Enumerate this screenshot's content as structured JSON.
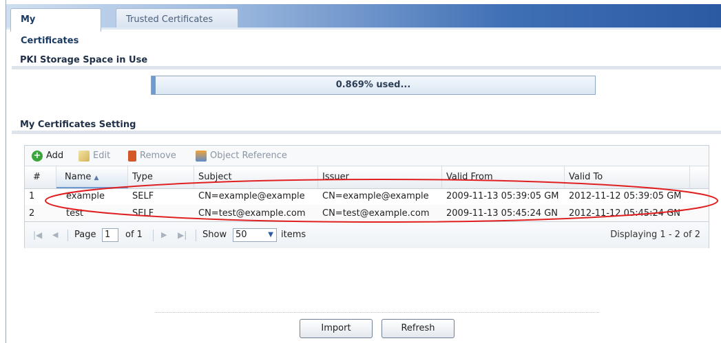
{
  "tabs": [
    {
      "label": "My Certificates",
      "active": true
    },
    {
      "label": "Trusted Certificates",
      "active": false
    }
  ],
  "storage": {
    "section_title": "PKI Storage Space in Use",
    "used_text": "0.869% used...",
    "used_percent": 0.869
  },
  "certs": {
    "section_title": "My Certificates Setting",
    "toolbar": {
      "add": "Add",
      "edit": "Edit",
      "remove": "Remove",
      "object_reference": "Object Reference"
    },
    "columns": [
      "#",
      "Name",
      "Type",
      "Subject",
      "Issuer",
      "Valid From",
      "Valid To"
    ],
    "rows": [
      {
        "num": "1",
        "name": "example",
        "type": "SELF",
        "subject": "CN=example@example",
        "issuer": "CN=example@example",
        "valid_from": "2009-11-13 05:39:05 GM",
        "valid_to": "2012-11-12 05:39:05 GM"
      },
      {
        "num": "2",
        "name": "test",
        "type": "SELF",
        "subject": "CN=test@example.com",
        "issuer": "CN=test@example.com",
        "valid_from": "2009-11-13 05:45:24 GN",
        "valid_to": "2012-11-12 05:45:24 GN"
      }
    ],
    "pager": {
      "page_label": "Page",
      "page_value": "1",
      "of_label": "of 1",
      "show_label": "Show",
      "show_value": "50",
      "items_label": "items",
      "displaying": "Displaying 1 - 2 of 2"
    }
  },
  "buttons": {
    "import": "Import",
    "refresh": "Refresh"
  },
  "colors": {
    "accent": "#2b5aa2",
    "annotation": "#e02020",
    "add_icon": "#3aa53a",
    "remove_icon": "#d4572a"
  }
}
